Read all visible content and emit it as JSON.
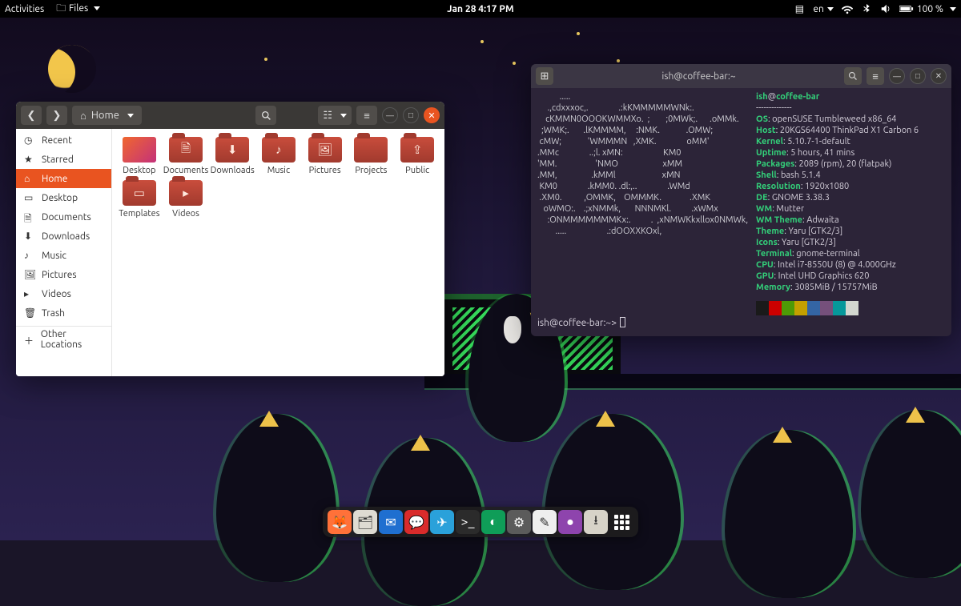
{
  "panel": {
    "activities": "Activities",
    "files_menu": "Files",
    "clock": "Jan 28  4:17 PM",
    "lang": "en",
    "battery": "100 %"
  },
  "file_manager": {
    "path_label": "Home",
    "sidebar": [
      {
        "label": "Recent",
        "icon": "clock"
      },
      {
        "label": "Starred",
        "icon": "star"
      },
      {
        "label": "Home",
        "icon": "home",
        "active": true
      },
      {
        "label": "Desktop",
        "icon": "desktop"
      },
      {
        "label": "Documents",
        "icon": "doc"
      },
      {
        "label": "Downloads",
        "icon": "down"
      },
      {
        "label": "Music",
        "icon": "music"
      },
      {
        "label": "Pictures",
        "icon": "pic"
      },
      {
        "label": "Videos",
        "icon": "vid"
      },
      {
        "label": "Trash",
        "icon": "trash"
      },
      {
        "label": "Other Locations",
        "icon": "plus",
        "sep_before": true
      }
    ],
    "folders": [
      {
        "label": "Desktop",
        "glyph": "",
        "type": "desktop"
      },
      {
        "label": "Documents",
        "glyph": "🗎"
      },
      {
        "label": "Downloads",
        "glyph": "⬇"
      },
      {
        "label": "Music",
        "glyph": "♪"
      },
      {
        "label": "Pictures",
        "glyph": "🖼"
      },
      {
        "label": "Projects",
        "glyph": ""
      },
      {
        "label": "Public",
        "glyph": "⇪"
      },
      {
        "label": "Templates",
        "glyph": "▭"
      },
      {
        "label": "Videos",
        "glyph": "▸"
      }
    ]
  },
  "terminal": {
    "title": "ish@coffee-bar:~",
    "userhost_user": "ish",
    "userhost_at": "@",
    "userhost_host": "coffee-bar",
    "prompt": "ish@coffee-bar:~>",
    "neofetch": [
      {
        "k": "OS",
        "v": "openSUSE Tumbleweed x86_64"
      },
      {
        "k": "Host",
        "v": "20KGS64400 ThinkPad X1 Carbon 6"
      },
      {
        "k": "Kernel",
        "v": "5.10.7-1-default"
      },
      {
        "k": "Uptime",
        "v": "5 hours, 41 mins"
      },
      {
        "k": "Packages",
        "v": "2089 (rpm), 20 (flatpak)"
      },
      {
        "k": "Shell",
        "v": "bash 5.1.4"
      },
      {
        "k": "Resolution",
        "v": "1920x1080"
      },
      {
        "k": "DE",
        "v": "GNOME 3.38.3"
      },
      {
        "k": "WM",
        "v": "Mutter"
      },
      {
        "k": "WM Theme",
        "v": "Adwaita"
      },
      {
        "k": "Theme",
        "v": "Yaru [GTK2/3]"
      },
      {
        "k": "Icons",
        "v": "Yaru [GTK2/3]"
      },
      {
        "k": "Terminal",
        "v": "gnome-terminal"
      },
      {
        "k": "CPU",
        "v": "Intel i7-8550U (8) @ 4.000GHz"
      },
      {
        "k": "GPU",
        "v": "Intel UHD Graphics 620"
      },
      {
        "k": "Memory",
        "v": "3085MiB / 15757MiB"
      }
    ],
    "ascii": "           .....\n     .,cdxxxoc,.               .:kKMMMMMWNk:.\n    cKMMN0OOOKWMMXo.  ;        ;0MWk;.      .oMMk.\n  ;WMK;.       .lKMMMM,     :NMK.             .OMW;\n cMW;             'WMMMN   ,XMK.               oMM'\n.MMc               ..;l. xMN:                    KM0\n'MM.                   'NMO                      xMM\n.MM,                 .kMMl                       xMN\n KM0               .kMM0. .dl:,..               .WMd\n .XM0.           ,OMMK,    OMMMK.              .XMK\n   oWMO:.    .;xNMMk,       NNNMKl.          .xWMx\n     :ONMMMMMMMKx:.          .  ,xNMWKkxllox0NMWk,\n         .....                    .:dOOXXKOxl,",
    "swatches": [
      "#1a1a1a",
      "#cc0000",
      "#4e9a06",
      "#c4a000",
      "#3465a4",
      "#75507b",
      "#06989a",
      "#d3d7cf",
      "#555753",
      "#ef2929",
      "#8ae234",
      "#fce94f",
      "#729fcf",
      "#ad7fa8",
      "#34e2e2",
      "#eeeeec"
    ]
  },
  "dock": {
    "items": [
      {
        "name": "firefox",
        "color": "#ff7139",
        "glyph": "🦊"
      },
      {
        "name": "files",
        "color": "#dedbd2",
        "glyph": "🗂"
      },
      {
        "name": "thunderbird",
        "color": "#1f6fd0",
        "glyph": "✉"
      },
      {
        "name": "chat",
        "color": "#d92b2b",
        "glyph": "💬"
      },
      {
        "name": "telegram",
        "color": "#2aa1da",
        "glyph": "✈"
      },
      {
        "name": "terminal",
        "color": "#2b2b2b",
        "glyph": ">_"
      },
      {
        "name": "vpn",
        "color": "#0f9d58",
        "glyph": "◐"
      },
      {
        "name": "settings",
        "color": "#5b5b5b",
        "glyph": "⚙"
      },
      {
        "name": "text-editor",
        "color": "#efefef",
        "glyph": "✎"
      },
      {
        "name": "podcasts",
        "color": "#8e44ad",
        "glyph": "●"
      },
      {
        "name": "software",
        "color": "#d7d3c8",
        "glyph": "⭳"
      },
      {
        "name": "app-grid",
        "color": "transparent",
        "glyph": "grid"
      }
    ]
  }
}
